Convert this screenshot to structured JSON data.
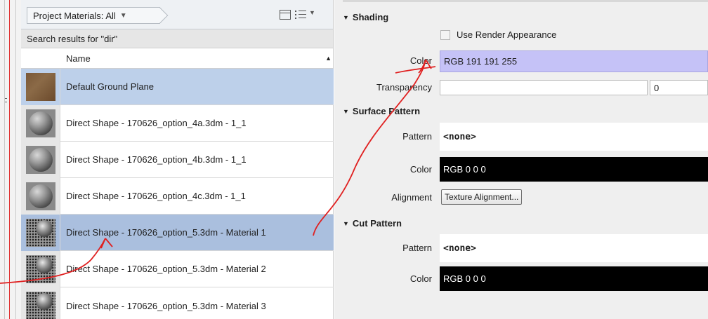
{
  "browser": {
    "filter_label": "Project Materials: All",
    "search_results": "Search results for \"dir\"",
    "column_name": "Name",
    "rows": [
      {
        "label": "Default Ground Plane",
        "thumb": "ground"
      },
      {
        "label": "Direct Shape - 170626_option_4a.3dm - 1_1",
        "thumb": "sphere"
      },
      {
        "label": "Direct Shape - 170626_option_4b.3dm - 1_1",
        "thumb": "sphere"
      },
      {
        "label": "Direct Shape - 170626_option_4c.3dm - 1_1",
        "thumb": "sphere"
      },
      {
        "label": "Direct Shape - 170626_option_5.3dm - Material 1",
        "thumb": "perforated"
      },
      {
        "label": "Direct Shape - 170626_option_5.3dm - Material 2",
        "thumb": "perforated"
      },
      {
        "label": "Direct Shape - 170626_option_5.3dm - Material 3",
        "thumb": "perforated"
      }
    ]
  },
  "properties": {
    "shading": {
      "title": "Shading",
      "use_render_appearance": "Use Render Appearance",
      "color_label": "Color",
      "color_value": "RGB 191 191 255",
      "transparency_label": "Transparency",
      "transparency_value": "0"
    },
    "surface_pattern": {
      "title": "Surface Pattern",
      "pattern_label": "Pattern",
      "pattern_value": "<none>",
      "color_label": "Color",
      "color_value": "RGB 0 0 0",
      "alignment_label": "Alignment",
      "alignment_button": "Texture Alignment..."
    },
    "cut_pattern": {
      "title": "Cut Pattern",
      "pattern_label": "Pattern",
      "pattern_value": "<none>",
      "color_label": "Color",
      "color_value": "RGB 0 0 0"
    }
  },
  "colors": {
    "shading_swatch": "#c5c2f7",
    "selection": "#bdd0ea",
    "annotation": "#e02020"
  }
}
